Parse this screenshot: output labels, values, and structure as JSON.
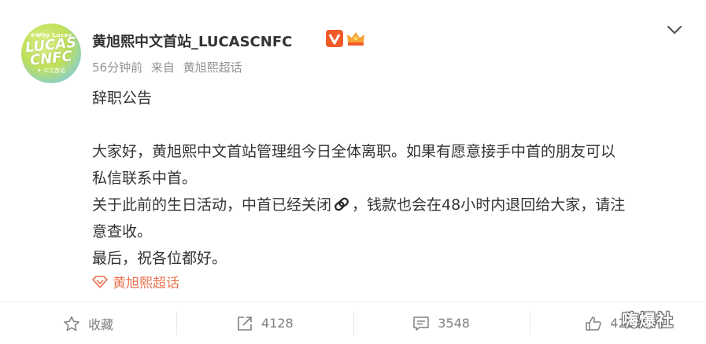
{
  "post": {
    "avatar": {
      "top": "#Why Lucas",
      "name_line1": "LUCAS",
      "name_line2": "CNFC",
      "sub": "✦ 中文首站"
    },
    "username": "黄旭熙中文首站_LUCASCNFC",
    "time": "56分钟前",
    "source_prefix": "来自",
    "source": "黄旭熙超话",
    "lines": [
      "辞职公告",
      "大家好，黄旭熙中文首站管理组今日全体离职。如果有愿意接手中首的朋友可以",
      "私信联系中首。",
      "关于此前的生日活动，中首已经关闭",
      "，钱款也会在48小时内退回给大家，请注",
      "意查收。",
      "最后，祝各位都好。"
    ],
    "topic": "黄旭熙超话"
  },
  "actions": {
    "favorite": "收藏",
    "repost": "4128",
    "comment": "3548",
    "like": "42086"
  },
  "watermark": "嗨爆社",
  "colors": {
    "topic": "#eb7350",
    "verified": "#f25a29",
    "text": "#333333",
    "muted": "#939393"
  }
}
